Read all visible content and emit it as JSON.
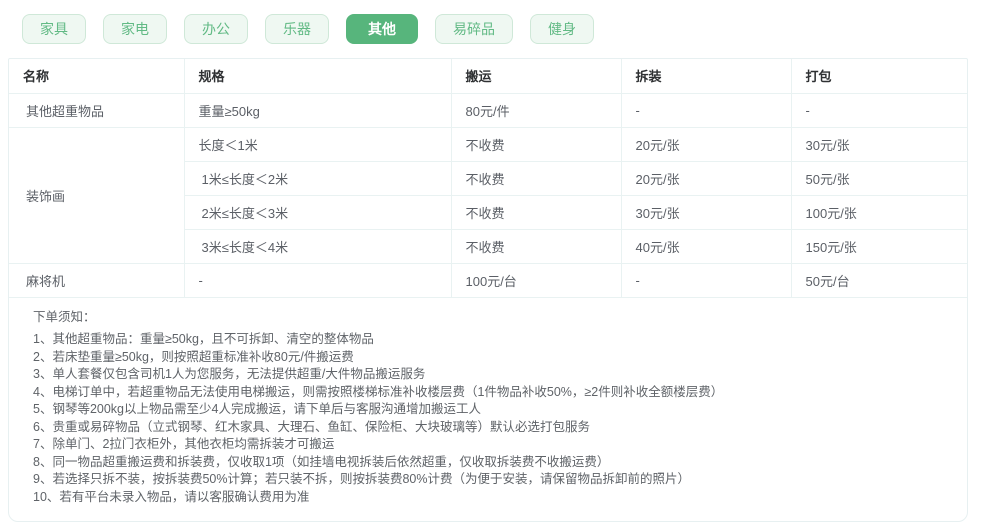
{
  "colors": {
    "active_tab_bg": "#57b57c",
    "inactive_tab_bg": "#eff8f2",
    "inactive_tab_text": "#62ba85",
    "table_border": "#e9f2f2",
    "header_text": "#2f3133",
    "body_text": "#5b5f66"
  },
  "tabs": {
    "items": [
      {
        "id": "furniture",
        "label": "家具",
        "active": false
      },
      {
        "id": "appliance",
        "label": "家电",
        "active": false
      },
      {
        "id": "office",
        "label": "办公",
        "active": false
      },
      {
        "id": "instrument",
        "label": "乐器",
        "active": false
      },
      {
        "id": "other",
        "label": "其他",
        "active": true
      },
      {
        "id": "fragile",
        "label": "易碎品",
        "active": false
      },
      {
        "id": "fitness",
        "label": "健身",
        "active": false
      }
    ]
  },
  "table": {
    "columns": [
      "名称",
      "规格",
      "搬运",
      "拆装",
      "打包"
    ],
    "rows": [
      {
        "cells": [
          {
            "t": "其他超重物品"
          },
          {
            "t": "重量≥50kg"
          },
          {
            "t": "80元/件"
          },
          {
            "t": "-"
          },
          {
            "t": "-"
          }
        ]
      },
      {
        "cells": [
          {
            "t": "装饰画",
            "rowspan": 4
          },
          {
            "t": "长度＜1米"
          },
          {
            "t": "不收费"
          },
          {
            "t": "20元/张"
          },
          {
            "t": "30元/张"
          }
        ]
      },
      {
        "cells": [
          {
            "t": "1米≤长度＜2米"
          },
          {
            "t": "不收费"
          },
          {
            "t": "20元/张"
          },
          {
            "t": "50元/张"
          }
        ]
      },
      {
        "cells": [
          {
            "t": "2米≤长度＜3米"
          },
          {
            "t": "不收费"
          },
          {
            "t": "30元/张"
          },
          {
            "t": "100元/张"
          }
        ]
      },
      {
        "cells": [
          {
            "t": "3米≤长度＜4米"
          },
          {
            "t": "不收费"
          },
          {
            "t": "40元/张"
          },
          {
            "t": "150元/张"
          }
        ]
      },
      {
        "cells": [
          {
            "t": "麻将机"
          },
          {
            "t": "-"
          },
          {
            "t": "100元/台"
          },
          {
            "t": "-"
          },
          {
            "t": "50元/台"
          }
        ]
      }
    ]
  },
  "notes": {
    "title": "下单须知：",
    "items": [
      "1、其他超重物品：重量≥50kg，且不可拆卸、清空的整体物品",
      "2、若床垫重量≥50kg，则按照超重标准补收80元/件搬运费",
      "3、单人套餐仅包含司机1人为您服务，无法提供超重/大件物品搬运服务",
      "4、电梯订单中，若超重物品无法使用电梯搬运，则需按照楼梯标准补收楼层费（1件物品补收50%，≥2件则补收全额楼层费）",
      "5、钢琴等200kg以上物品需至少4人完成搬运，请下单后与客服沟通增加搬运工人",
      "6、贵重或易碎物品（立式钢琴、红木家具、大理石、鱼缸、保险柜、大块玻璃等）默认必选打包服务",
      "7、除单门、2拉门衣柜外，其他衣柜均需拆装才可搬运",
      "8、同一物品超重搬运费和拆装费，仅收取1项（如挂墙电视拆装后依然超重，仅收取拆装费不收搬运费）",
      "9、若选择只拆不装，按拆装费50%计算；若只装不拆，则按拆装费80%计费（为便于安装，请保留物品拆卸前的照片）",
      "10、若有平台未录入物品，请以客服确认费用为准"
    ]
  }
}
